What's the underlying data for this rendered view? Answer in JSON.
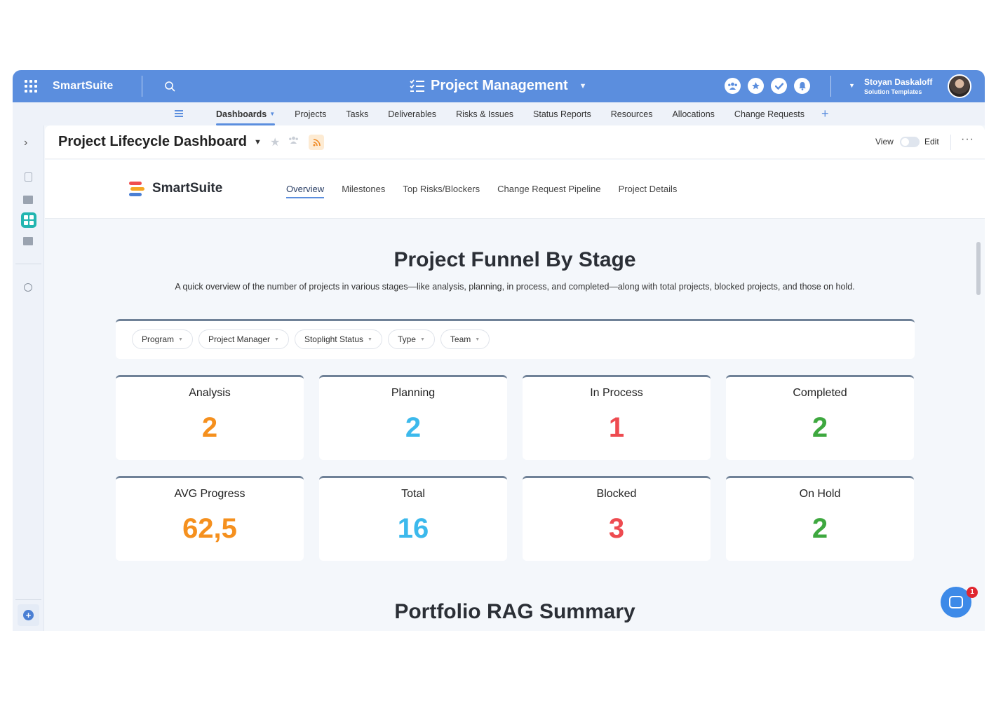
{
  "topbar": {
    "brand": "SmartSuite",
    "app_title": "Project Management",
    "user_name": "Stoyan Daskaloff",
    "user_subtitle": "Solution Templates",
    "icons": [
      "members-icon",
      "star-icon",
      "check-icon",
      "bell-icon"
    ],
    "accent_color": "#5b8ede"
  },
  "nav": {
    "items": [
      {
        "label": "Dashboards",
        "active": true
      },
      {
        "label": "Projects"
      },
      {
        "label": "Tasks"
      },
      {
        "label": "Deliverables"
      },
      {
        "label": "Risks & Issues"
      },
      {
        "label": "Status Reports"
      },
      {
        "label": "Resources"
      },
      {
        "label": "Allocations"
      },
      {
        "label": "Change Requests"
      }
    ],
    "add_label": "+"
  },
  "page": {
    "title": "Project Lifecycle Dashboard",
    "view_label": "View",
    "edit_label": "Edit"
  },
  "subheader": {
    "logo_text": "SmartSuite",
    "tabs": [
      {
        "label": "Overview",
        "active": true
      },
      {
        "label": "Milestones"
      },
      {
        "label": "Top Risks/Blockers"
      },
      {
        "label": "Change Request Pipeline"
      },
      {
        "label": "Project Details"
      }
    ]
  },
  "section": {
    "title": "Project Funnel By Stage",
    "description": "A quick overview of the number of projects in various stages—like analysis, planning, in process, and completed—along with total projects, blocked projects, and those on hold."
  },
  "filters": [
    {
      "label": "Program"
    },
    {
      "label": "Project Manager"
    },
    {
      "label": "Stoplight Status"
    },
    {
      "label": "Type"
    },
    {
      "label": "Team"
    }
  ],
  "cards": [
    {
      "label": "Analysis",
      "value": "2",
      "color": "#f5901e"
    },
    {
      "label": "Planning",
      "value": "2",
      "color": "#3cb9ec"
    },
    {
      "label": "In Process",
      "value": "1",
      "color": "#ee4b50"
    },
    {
      "label": "Completed",
      "value": "2",
      "color": "#3ea83f"
    },
    {
      "label": "AVG Progress",
      "value": "62,5",
      "color": "#f5901e"
    },
    {
      "label": "Total",
      "value": "16",
      "color": "#3cb9ec"
    },
    {
      "label": "Blocked",
      "value": "3",
      "color": "#ee4b50"
    },
    {
      "label": "On Hold",
      "value": "2",
      "color": "#3ea83f"
    }
  ],
  "section2": {
    "title": "Portfolio RAG Summary"
  },
  "chat": {
    "badge": "1"
  }
}
